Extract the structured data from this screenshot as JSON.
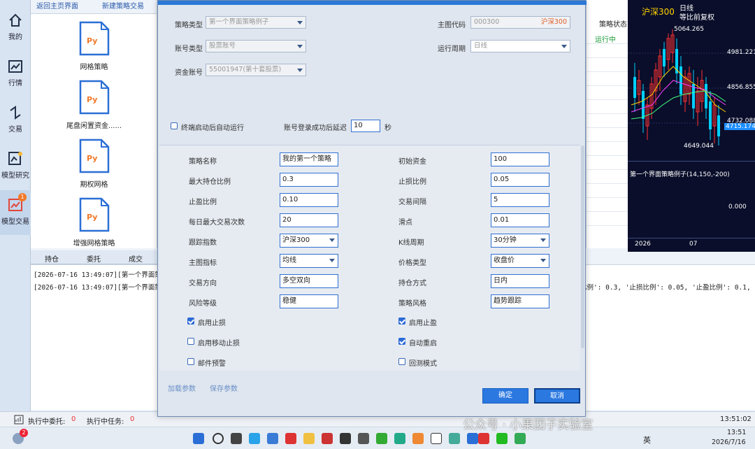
{
  "sidebar": {
    "items": [
      {
        "label": "我的",
        "icon": "home-icon"
      },
      {
        "label": "行情",
        "icon": "chart-icon"
      },
      {
        "label": "交易",
        "icon": "trade-icon"
      },
      {
        "label": "模型研究",
        "icon": "research-icon"
      },
      {
        "label": "模型交易",
        "icon": "model-trade-icon",
        "badge": "1"
      }
    ]
  },
  "list": {
    "back_link": "返回主页界面",
    "new_link": "新建策略交易",
    "strategies": [
      {
        "name": "网格策略",
        "file_label": "Py"
      },
      {
        "name": "尾盘闲置资金......",
        "file_label": "Py"
      },
      {
        "name": "期权网格",
        "file_label": "Py"
      },
      {
        "name": "增强网格策略",
        "file_label": "Py"
      }
    ]
  },
  "right_strip": {
    "header": "策略状态",
    "status": "运行中"
  },
  "chart": {
    "index_name": "沪深300",
    "period": "日线",
    "adjust": "等比前复权",
    "high_label": "5064.265",
    "low_label": "4649.044",
    "y_ticks": [
      "4981.221",
      "4856.855",
      "4732.088"
    ],
    "last_price": "4715.174",
    "sub_title": "第一个界面策略例子(14,150,-200)",
    "sub_zero": "0.000",
    "x_labels": [
      "2026",
      "07"
    ],
    "up_color": "#ff3030",
    "down_color": "#00d0ff"
  },
  "bottom_tabs": [
    "持仓",
    "委托",
    "成交"
  ],
  "logs": [
    "[2026-07-16 13:49:07][第一个界面策略",
    "[2026-07-16 13:49:07][第一个界面策略"
  ],
  "log_tail": "比例': 0.3, '止损比例': 0.05, '止盈比例': 0.1,",
  "status_bar": {
    "pending_orders_label": "执行中委托:",
    "pending_orders": "0",
    "pending_tasks_label": "执行中任务:",
    "pending_tasks": "0",
    "right_time": "13:51:02"
  },
  "taskbar": {
    "badge": "2",
    "ime": "英",
    "time": "13:51",
    "date": "2026/7/16",
    "watermark": "公众号 · 小果团子实验室"
  },
  "dialog": {
    "fields": {
      "strategy_type_label": "策略类型",
      "strategy_type_value": "第一个界面策略例子",
      "account_type_label": "账号类型",
      "account_type_value": "股票账号",
      "fund_account_label": "资金账号",
      "fund_account_value": "55001947(第十套股票)",
      "main_code_label": "主图代码",
      "main_code_value": "000300",
      "main_code_name": "沪深300",
      "period_label": "运行周期",
      "period_value": "日线"
    },
    "autorun_label": "终端启动后自动运行",
    "delay_label": "账号登录成功后延迟",
    "delay_value": "10",
    "delay_unit": "秒",
    "params": {
      "name_label": "策略名称",
      "name_value": "我的第一个策略",
      "init_cap_label": "初始资金",
      "init_cap_value": "100",
      "max_pos_label": "最大持仓比例",
      "max_pos_value": "0.3",
      "stop_loss_label": "止损比例",
      "stop_loss_value": "0.05",
      "take_profit_label": "止盈比例",
      "take_profit_value": "0.10",
      "interval_label": "交易间隔",
      "interval_value": "5",
      "max_trades_label": "每日最大交易次数",
      "max_trades_value": "20",
      "slippage_label": "滑点",
      "slippage_value": "0.01",
      "index_label": "跟踪指数",
      "index_value": "沪深300",
      "kline_label": "K线周期",
      "kline_value": "30分钟",
      "main_ind_label": "主图指标",
      "main_ind_value": "均线",
      "price_type_label": "价格类型",
      "price_type_value": "收盘价",
      "direction_label": "交易方向",
      "direction_value": "多空双向",
      "hold_label": "持仓方式",
      "hold_value": "日内",
      "risk_label": "风险等级",
      "risk_value": "稳健",
      "style_label": "策略风格",
      "style_value": "趋势跟踪"
    },
    "checks": {
      "enable_sl": "启用止损",
      "enable_tp": "启用止盈",
      "trailing": "启用移动止损",
      "auto_restart": "自动重启",
      "email": "邮件预警",
      "backtest": "回测模式"
    },
    "load_params": "加载参数",
    "save_params": "保存参数",
    "ok": "确定",
    "cancel": "取消"
  }
}
